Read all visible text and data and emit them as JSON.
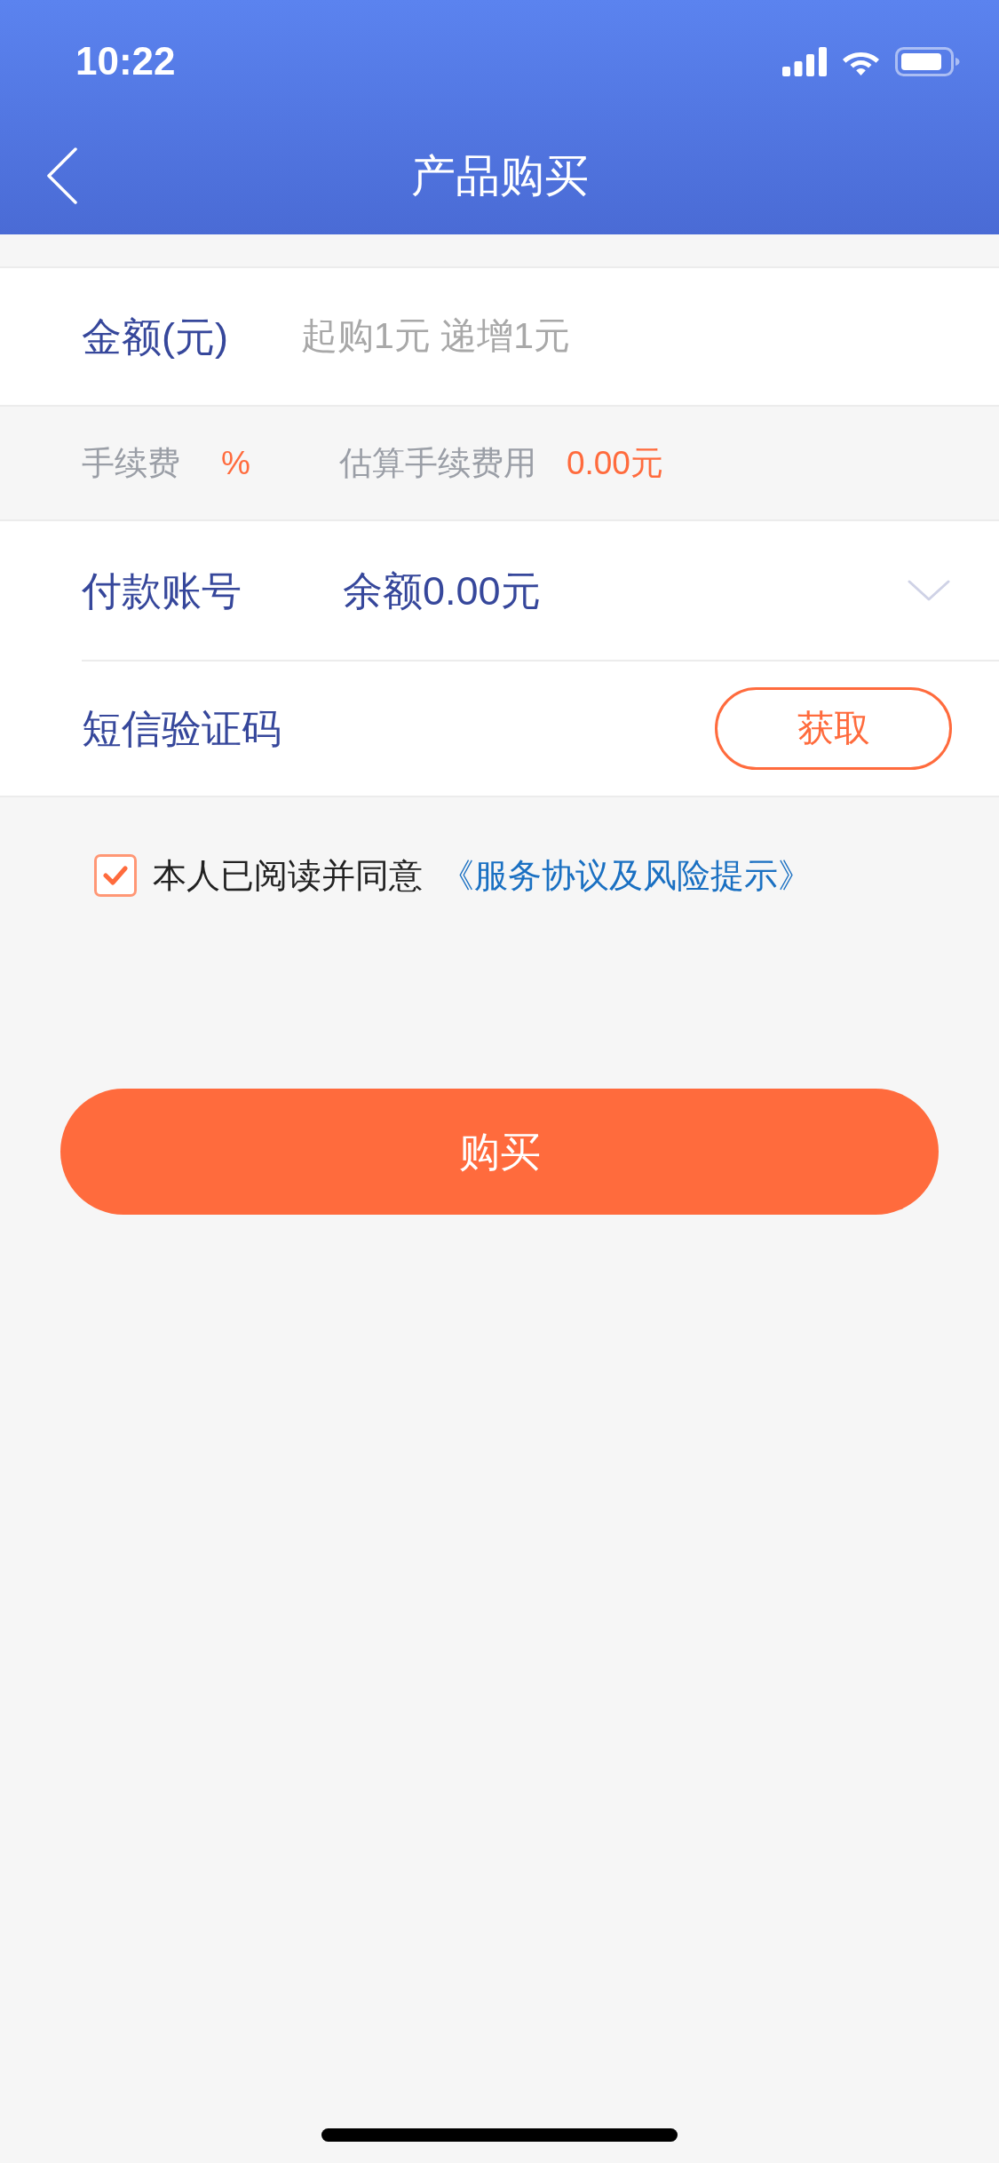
{
  "status_bar": {
    "time": "10:22"
  },
  "header": {
    "title": "产品购买"
  },
  "amount_field": {
    "label": "金额(元)",
    "placeholder": "起购1元 递增1元"
  },
  "fee_row": {
    "fee_label": "手续费",
    "fee_value": "%",
    "estimate_label": "估算手续费用",
    "estimate_value": "0.00元"
  },
  "account_field": {
    "label": "付款账号",
    "value": "余额0.00元"
  },
  "sms_field": {
    "label": "短信验证码",
    "button": "获取"
  },
  "agreement": {
    "checked": true,
    "text": "本人已阅读并同意",
    "link": "《服务协议及风险提示》"
  },
  "buy_button": {
    "label": "购买"
  }
}
